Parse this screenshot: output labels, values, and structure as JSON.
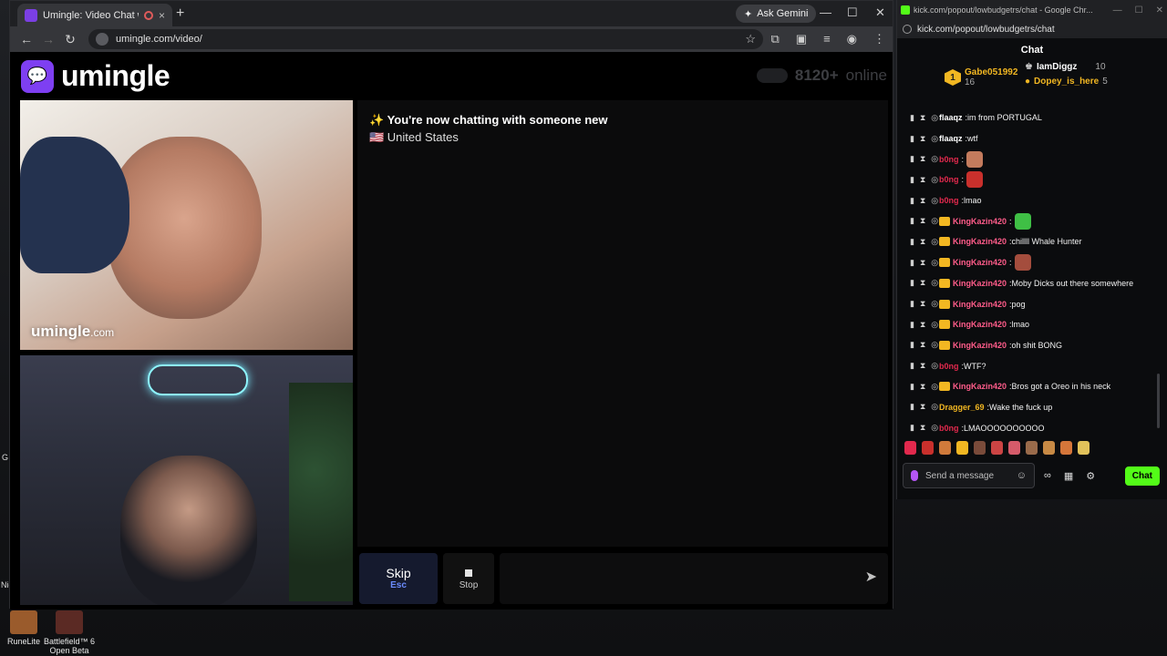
{
  "desktop": {
    "icons": [
      {
        "label": "RuneLite",
        "color": "#9a5b2c"
      },
      {
        "label": "Battlefield™ 6 Open Beta",
        "color": "#5b2a24"
      }
    ],
    "edge_labels": [
      "Nig",
      "G"
    ]
  },
  "browser": {
    "tab_title": "Umingle: Video Chat with S",
    "tab_close": "×",
    "new_tab": "+",
    "gemini_label": "Ask Gemini",
    "url": "umingle.com/video/"
  },
  "site": {
    "logo_text": "umingle",
    "online_count": "8120+",
    "online_label": "online",
    "watermark": "umingle",
    "watermark_suffix": ".com",
    "status_line": "✨ You're now chatting with someone new",
    "country": "🇺🇸 United States",
    "skip_label": "Skip",
    "skip_key": "Esc",
    "stop_label": "Stop"
  },
  "popup": {
    "window_title": "kick.com/popout/lowbudgetrs/chat - Google Chr...",
    "url": "kick.com/popout/lowbudgetrs/chat",
    "chat_title": "Chat",
    "gifters": [
      {
        "name": "Gabe051992",
        "count": "16",
        "color": "#f2b722"
      },
      {
        "name": "IamDiggz",
        "count": "10",
        "color": "#ffffff"
      },
      {
        "name": "Dopey_is_here",
        "count": "5",
        "color": "#f2b722"
      }
    ],
    "rank": "1",
    "messages": [
      {
        "user": "flaaqz",
        "color": "#ffffff",
        "crown": false,
        "text": "im from PORTUGAL",
        "emote": ""
      },
      {
        "user": "flaaqz",
        "color": "#ffffff",
        "crown": false,
        "text": "wtf",
        "emote": ""
      },
      {
        "user": "b0ng",
        "color": "#e2294d",
        "crown": false,
        "text": "",
        "emote": "#c47b5d"
      },
      {
        "user": "b0ng",
        "color": "#e2294d",
        "crown": false,
        "text": "",
        "emote": "#c9302c"
      },
      {
        "user": "b0ng",
        "color": "#e2294d",
        "crown": false,
        "text": "lmao",
        "emote": ""
      },
      {
        "user": "KingKazin420",
        "color": "#ff5c8a",
        "crown": true,
        "text": "",
        "emote": "#3fbf45"
      },
      {
        "user": "KingKazin420",
        "color": "#ff5c8a",
        "crown": true,
        "text": "chillll Whale Hunter",
        "emote": ""
      },
      {
        "user": "KingKazin420",
        "color": "#ff5c8a",
        "crown": true,
        "text": "",
        "emote": "#a44d3d"
      },
      {
        "user": "KingKazin420",
        "color": "#ff5c8a",
        "crown": true,
        "text": "Moby Dicks out there somewhere",
        "emote": ""
      },
      {
        "user": "KingKazin420",
        "color": "#ff5c8a",
        "crown": true,
        "text": "pog",
        "emote": ""
      },
      {
        "user": "KingKazin420",
        "color": "#ff5c8a",
        "crown": true,
        "text": "lmao",
        "emote": ""
      },
      {
        "user": "KingKazin420",
        "color": "#ff5c8a",
        "crown": true,
        "text": "oh shit BONG",
        "emote": ""
      },
      {
        "user": "b0ng",
        "color": "#e2294d",
        "crown": false,
        "text": "WTF?",
        "emote": ""
      },
      {
        "user": "KingKazin420",
        "color": "#ff5c8a",
        "crown": true,
        "text": "Bros got a Oreo in his neck",
        "emote": ""
      },
      {
        "user": "Dragger_69",
        "color": "#f2b722",
        "crown": false,
        "text": "Wake the fuck up",
        "emote": ""
      },
      {
        "user": "b0ng",
        "color": "#e2294d",
        "crown": false,
        "text": "LMAOOOOOOOOOO",
        "emote": ""
      }
    ],
    "emote_colors": [
      "#e2294d",
      "#c9302c",
      "#d07a3b",
      "#f2b722",
      "#7a4b3a",
      "#c44",
      "#d65b6a",
      "#9a6b4b",
      "#c88a45",
      "#d5763a",
      "#e2c25a"
    ],
    "input_placeholder": "Send a message",
    "send_label": "Chat"
  }
}
